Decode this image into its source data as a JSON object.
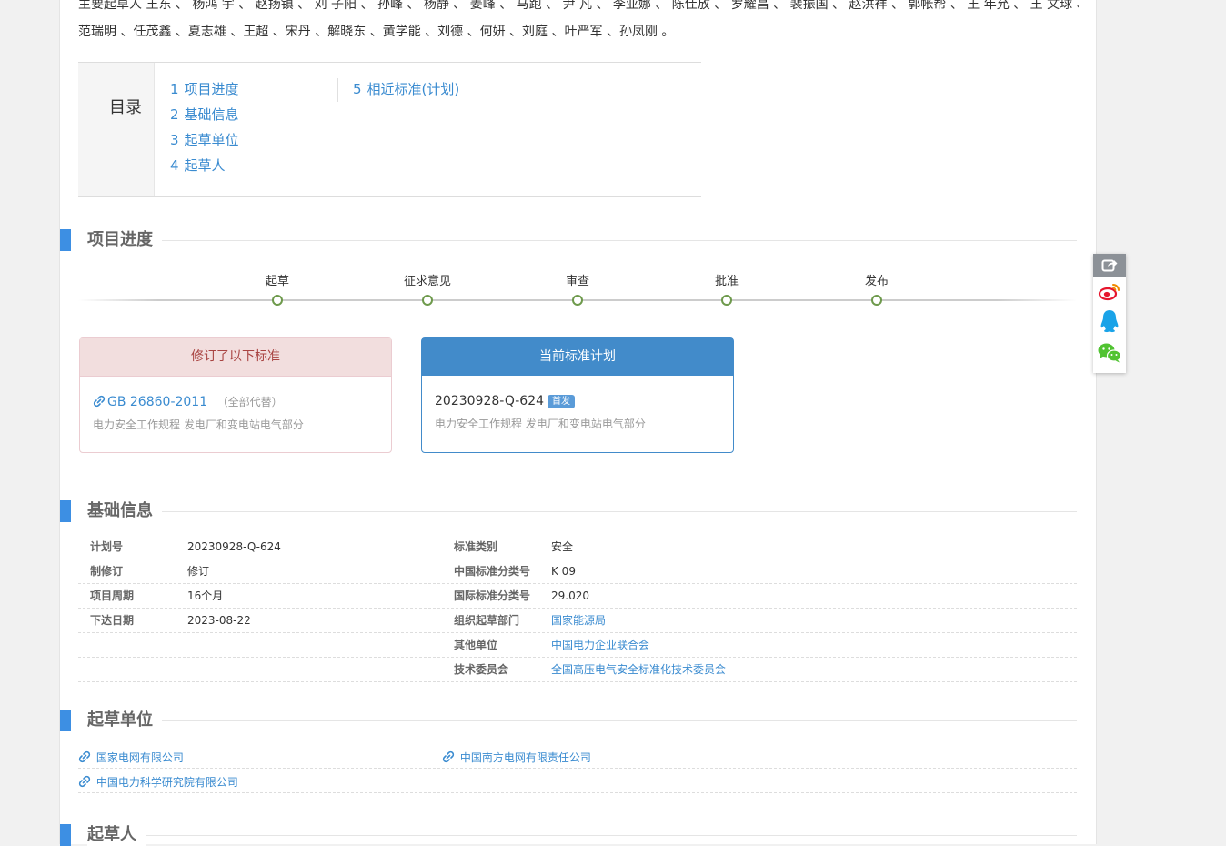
{
  "authors": {
    "line1": "主要起草人 王东 、 杨鸿 宇 、 赵扬镇 、 刘 子阳 、 孙峰 、 杨静 、 姜峰 、 马跑 、 尹 凡 、 李亚娜 、 陈佳放 、 罗耀昌 、 裴振国 、 赵洪祥 、 郭帐帮 、 王 年允 、 王 文球 、 杨剧云 、",
    "line2": "范瑞明 、任茂鑫 、夏志雄 、王超 、宋丹 、解晓东 、黄学能 、刘德 、何妍 、刘庭 、叶严军 、孙凤刚 。"
  },
  "toc": {
    "title": "目录",
    "items": [
      {
        "num": "1",
        "label": "项目进度"
      },
      {
        "num": "2",
        "label": "基础信息"
      },
      {
        "num": "3",
        "label": "起草单位"
      },
      {
        "num": "4",
        "label": "起草人"
      },
      {
        "num": "5",
        "label": "相近标准(计划)"
      }
    ]
  },
  "sections": {
    "progress": "项目进度",
    "basic": "基础信息",
    "units": "起草单位",
    "drafters": "起草人"
  },
  "timeline": [
    "起草",
    "征求意见",
    "审查",
    "批准",
    "发布"
  ],
  "revised_card": {
    "header": "修订了以下标准",
    "code": "GB 26860-2011",
    "note": "（全部代替）",
    "desc": "电力安全工作规程 发电厂和变电站电气部分"
  },
  "current_card": {
    "header": "当前标准计划",
    "code": "20230928-Q-624",
    "badge": "首发",
    "desc": "电力安全工作规程 发电厂和变电站电气部分"
  },
  "info_rows": [
    {
      "k1": "计划号",
      "v1": "20230928-Q-624",
      "k2": "标准类别",
      "v2": "安全",
      "v2_link": false
    },
    {
      "k1": "制修订",
      "v1": "修订",
      "k2": "中国标准分类号",
      "v2": "K 09",
      "v2_link": false
    },
    {
      "k1": "项目周期",
      "v1": "16个月",
      "k2": "国际标准分类号",
      "v2": "29.020",
      "v2_link": false
    },
    {
      "k1": "下达日期",
      "v1": "2023-08-22",
      "k2": "组织起草部门",
      "v2": "国家能源局",
      "v2_link": true
    },
    {
      "k1": "",
      "v1": "",
      "k2": "其他单位",
      "v2": "中国电力企业联合会",
      "v2_link": true
    },
    {
      "k1": "",
      "v1": "",
      "k2": "技术委员会",
      "v2": "全国高压电气安全标准化技术委员会",
      "v2_link": true
    }
  ],
  "units": [
    [
      "国家电网有限公司",
      "中国南方电网有限责任公司"
    ],
    [
      "中国电力科学研究院有限公司",
      ""
    ]
  ],
  "share": {
    "icons": [
      "share-icon",
      "weibo-icon",
      "qq-icon",
      "wechat-icon"
    ]
  },
  "colors": {
    "accent": "#3d8fe3",
    "link": "#3a8bd0",
    "danger_bg": "#f2dede",
    "danger_text": "#a94442",
    "primary": "#428bca",
    "timeline_dot": "#6e9a4c"
  }
}
